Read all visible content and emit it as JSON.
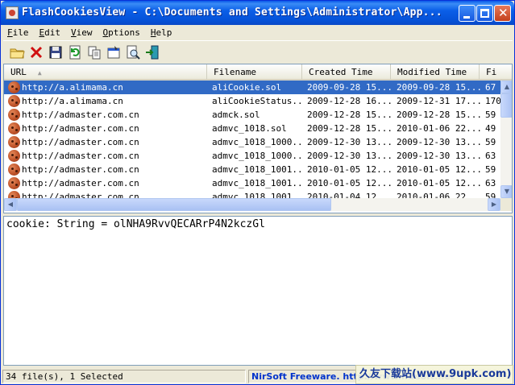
{
  "window": {
    "title": "FlashCookiesView  -  C:\\Documents and Settings\\Administrator\\App..."
  },
  "menu": {
    "items": [
      {
        "first": "F",
        "rest": "ile"
      },
      {
        "first": "E",
        "rest": "dit"
      },
      {
        "first": "V",
        "rest": "iew"
      },
      {
        "first": "O",
        "rest": "ptions"
      },
      {
        "first": "H",
        "rest": "elp"
      }
    ]
  },
  "toolbar": {
    "icons": [
      "folder-open-icon",
      "delete-icon",
      "save-icon",
      "refresh-icon",
      "copy-icon",
      "properties-icon",
      "find-icon",
      "exit-icon"
    ]
  },
  "list": {
    "columns": [
      "URL",
      "Filename",
      "Created Time",
      "Modified Time",
      "Fi"
    ],
    "rows": [
      {
        "url": "http://a.alimama.cn",
        "filename": "aliCookie.sol",
        "created": "2009-09-28 15...",
        "modified": "2009-09-28 15...",
        "size": "67",
        "selected": true
      },
      {
        "url": "http://a.alimama.cn",
        "filename": "aliCookieStatus...",
        "created": "2009-12-28 16...",
        "modified": "2009-12-31 17...",
        "size": "170",
        "selected": false
      },
      {
        "url": "http://admaster.com.cn",
        "filename": "admck.sol",
        "created": "2009-12-28 15...",
        "modified": "2009-12-28 15...",
        "size": "59",
        "selected": false
      },
      {
        "url": "http://admaster.com.cn",
        "filename": "admvc_1018.sol",
        "created": "2009-12-28 15...",
        "modified": "2010-01-06 22...",
        "size": "49",
        "selected": false
      },
      {
        "url": "http://admaster.com.cn",
        "filename": "admvc_1018_1000...",
        "created": "2009-12-30 13...",
        "modified": "2009-12-30 13...",
        "size": "59",
        "selected": false
      },
      {
        "url": "http://admaster.com.cn",
        "filename": "admvc_1018_1000...",
        "created": "2009-12-30 13...",
        "modified": "2009-12-30 13...",
        "size": "63",
        "selected": false
      },
      {
        "url": "http://admaster.com.cn",
        "filename": "admvc_1018_1001...",
        "created": "2010-01-05 12...",
        "modified": "2010-01-05 12...",
        "size": "59",
        "selected": false
      },
      {
        "url": "http://admaster.com.cn",
        "filename": "admvc_1018_1001...",
        "created": "2010-01-05 12...",
        "modified": "2010-01-05 12...",
        "size": "63",
        "selected": false
      },
      {
        "url": "http://admaster.com.cn",
        "filename": "admvc_1018_1001...",
        "created": "2010-01-04 12...",
        "modified": "2010-01-06 22...",
        "size": "59",
        "selected": false
      }
    ]
  },
  "details": {
    "text": "cookie: String = olNHA9RvvQECARrP4N2kczGl"
  },
  "status": {
    "count": "34 file(s), 1 Selected",
    "link": "NirSoft Freeware.  http://www.nirsoft.net"
  },
  "watermark": {
    "text": "久友下载站(www.9upk.com)"
  },
  "colors": {
    "selection": "#316ac5",
    "titlebar": "#0b5fe8",
    "link": "#0033cc"
  }
}
